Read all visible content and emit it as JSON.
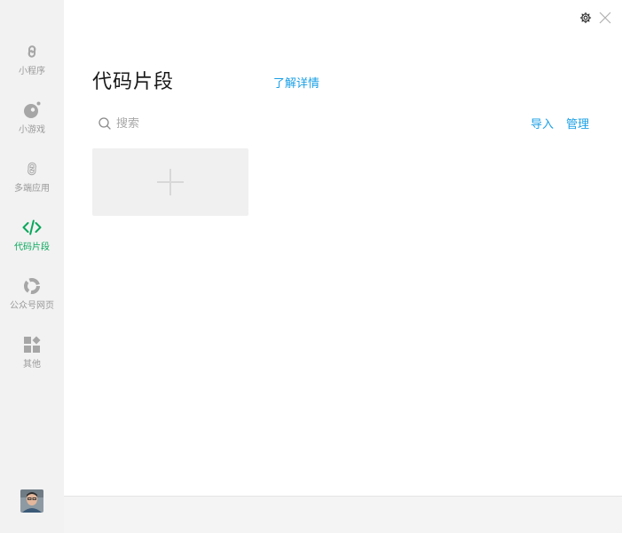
{
  "sidebar": {
    "items": [
      {
        "label": "小程序",
        "icon": "miniprogram-icon",
        "active": false
      },
      {
        "label": "小游戏",
        "icon": "minigame-icon",
        "active": false
      },
      {
        "label": "多端应用",
        "icon": "multi-platform-icon",
        "active": false
      },
      {
        "label": "代码片段",
        "icon": "code-icon",
        "active": true
      },
      {
        "label": "公众号网页",
        "icon": "official-account-icon",
        "active": false
      },
      {
        "label": "其他",
        "icon": "other-apps-icon",
        "active": false
      }
    ],
    "avatar": "user-avatar"
  },
  "header": {
    "settings_icon": "gear-icon",
    "close_icon": "close-icon"
  },
  "main": {
    "title": "代码片段",
    "learn_more": "了解详情",
    "search": {
      "placeholder": "搜索",
      "value": "",
      "icon": "search-icon"
    },
    "actions": {
      "import_label": "导入",
      "manage_label": "管理"
    },
    "add_card_icon": "plus-icon"
  },
  "colors": {
    "accent_green": "#07a75b",
    "link_blue": "#1aa0e6",
    "sidebar_bg": "#f2f2f2",
    "icon_gray": "#a6a6a6"
  }
}
